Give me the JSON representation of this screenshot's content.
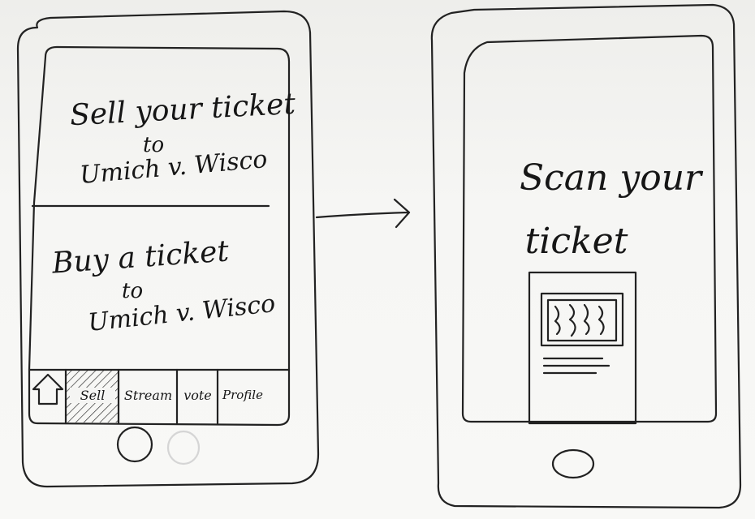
{
  "left_phone": {
    "sell_panel": {
      "title": "Sell your ticket",
      "connector": "to",
      "event": "Umich v. Wisco"
    },
    "buy_panel": {
      "title": "Buy a ticket",
      "connector": "to",
      "event": "Umich v. Wisco"
    },
    "tab_bar": {
      "items": [
        {
          "label": "",
          "icon": "home-arrow-icon"
        },
        {
          "label": "Sell",
          "active": true
        },
        {
          "label": "Stream"
        },
        {
          "label": "vote"
        },
        {
          "label": "Profile"
        }
      ]
    }
  },
  "flow_arrow": {
    "icon": "right-arrow-icon"
  },
  "right_phone": {
    "title_line1": "Scan your",
    "title_line2": "ticket",
    "ticket_icon": "ticket-icon"
  },
  "colors": {
    "ink": "#222222",
    "paper": "#f5f5f3"
  }
}
